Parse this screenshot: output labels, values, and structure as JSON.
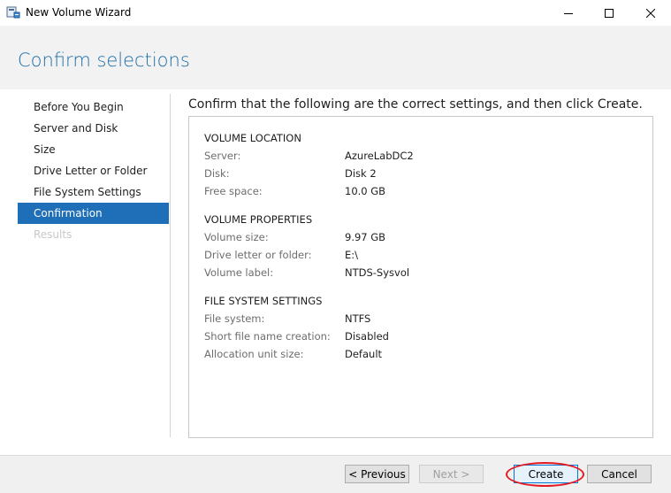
{
  "window": {
    "title": "New Volume Wizard"
  },
  "page": {
    "title": "Confirm selections"
  },
  "nav": {
    "items": [
      {
        "label": "Before You Begin",
        "state": "normal"
      },
      {
        "label": "Server and Disk",
        "state": "normal"
      },
      {
        "label": "Size",
        "state": "normal"
      },
      {
        "label": "Drive Letter or Folder",
        "state": "normal"
      },
      {
        "label": "File System Settings",
        "state": "normal"
      },
      {
        "label": "Confirmation",
        "state": "active"
      },
      {
        "label": "Results",
        "state": "disabled"
      }
    ]
  },
  "main": {
    "instruction": "Confirm that the following are the correct settings, and then click Create.",
    "sections": [
      {
        "heading": "VOLUME LOCATION",
        "rows": [
          {
            "label": "Server:",
            "value": "AzureLabDC2"
          },
          {
            "label": "Disk:",
            "value": "Disk 2"
          },
          {
            "label": "Free space:",
            "value": "10.0 GB"
          }
        ]
      },
      {
        "heading": "VOLUME PROPERTIES",
        "rows": [
          {
            "label": "Volume size:",
            "value": "9.97 GB"
          },
          {
            "label": "Drive letter or folder:",
            "value": "E:\\"
          },
          {
            "label": "Volume label:",
            "value": "NTDS-Sysvol"
          }
        ]
      },
      {
        "heading": "FILE SYSTEM SETTINGS",
        "rows": [
          {
            "label": "File system:",
            "value": "NTFS"
          },
          {
            "label": "Short file name creation:",
            "value": "Disabled"
          },
          {
            "label": "Allocation unit size:",
            "value": "Default"
          }
        ]
      }
    ]
  },
  "footer": {
    "previous_label": "< Previous",
    "next_label": "Next >",
    "create_label": "Create",
    "cancel_label": "Cancel"
  },
  "colors": {
    "accent": "#1f6fb8",
    "title": "#1f6fa8",
    "annotation": "#e21b22"
  },
  "icons": {
    "app": "volume-wizard-icon",
    "minimize": "minimize-icon",
    "maximize": "maximize-icon",
    "close": "close-icon"
  }
}
